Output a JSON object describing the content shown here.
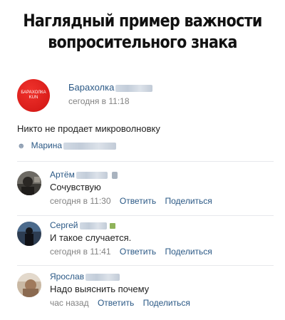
{
  "title": {
    "line1": "Наглядный пример важности",
    "line2": "вопросительного знака"
  },
  "post": {
    "group_logo_text": "БАРАХОЛКА",
    "group_logo_sub": "KUN",
    "group_name": "Барахолка",
    "time": "сегодня в 11:18",
    "text": "Никто не продает микроволновку",
    "author": "Марина"
  },
  "comments": [
    {
      "name": "Артём",
      "text": "Сочувствую",
      "time": "сегодня в 11:30",
      "reply": "Ответить",
      "share": "Поделиться"
    },
    {
      "name": "Сергей",
      "text": "И такое случается.",
      "time": "сегодня в 11:41",
      "reply": "Ответить",
      "share": "Поделиться"
    },
    {
      "name": "Ярослав",
      "text": "Надо выяснить почему",
      "time": "час назад",
      "reply": "Ответить",
      "share": "Поделиться"
    }
  ],
  "colors": {
    "link": "#2a5885",
    "meta": "#828282",
    "group_logo": "#d91d1a"
  }
}
